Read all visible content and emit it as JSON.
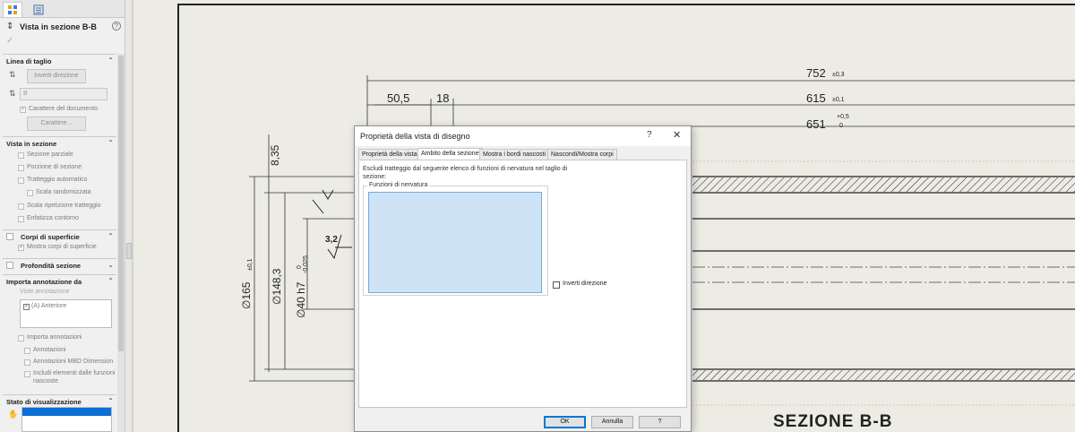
{
  "property_manager": {
    "title": "Vista in sezione B-B",
    "sections": {
      "cutting_line": {
        "label": "Linea di taglio",
        "reverse_button": "Inverti direzione",
        "letter_field": "B",
        "doc_font_checkbox": "Carattere del documento",
        "font_button": "Carattere..."
      },
      "section_view": {
        "label": "Vista in sezione",
        "options": [
          "Sezione parziale",
          "Porzione di sezione",
          "Tratteggio automatico",
          "Scala randomizzata",
          "Scala ripetizione tratteggio",
          "Enfatizza contorno"
        ]
      },
      "surface_bodies": {
        "label": "Corpi di superficie",
        "option": "Mostra corpi di superficie"
      },
      "section_depth": {
        "label": "Profondità sezione"
      },
      "import_annotation": {
        "label": "Importa annotazione da",
        "views_label": "Viste annotazione",
        "list_item": "(A) Anteriore",
        "options": [
          "Importa annotazioni",
          "Annotazioni",
          "Annotazioni MBD Dimension",
          "Includi elementi dalle funzioni",
          "nascoste"
        ]
      },
      "display_state": {
        "label": "Stato di visualizzazione"
      }
    }
  },
  "drawing": {
    "dims": {
      "d752": "752",
      "t752": "±0,3",
      "d615": "615",
      "t615": "±0,1",
      "d651": "651",
      "t651a": "+0,5",
      "t651b": "0",
      "d50": "50,5",
      "d18": "18",
      "d835": "8,35",
      "d165": "∅165",
      "t165": "±0,1",
      "d148": "∅148,3",
      "d40": "∅40 h7",
      "t40a": "0",
      "t40b": "-0,025",
      "rough": "3,2"
    },
    "view_label": "SEZIONE B-B"
  },
  "dialog": {
    "title": "Proprietà della vista di disegno",
    "help": "?",
    "close": "✕",
    "tabs": [
      "Proprietà della vista",
      "Ambito della sezione",
      "Mostra i bordi nascosti",
      "Nascondi/Mostra corpi"
    ],
    "description": "Escludi tratteggio dal seguente elenco di funzioni di nervatura nel taglio di sezione:",
    "group_label": "Funzioni di nervatura",
    "invert_label": "Inverti direzione",
    "buttons": {
      "ok": "OK",
      "cancel": "Annulla",
      "help": "?"
    }
  }
}
